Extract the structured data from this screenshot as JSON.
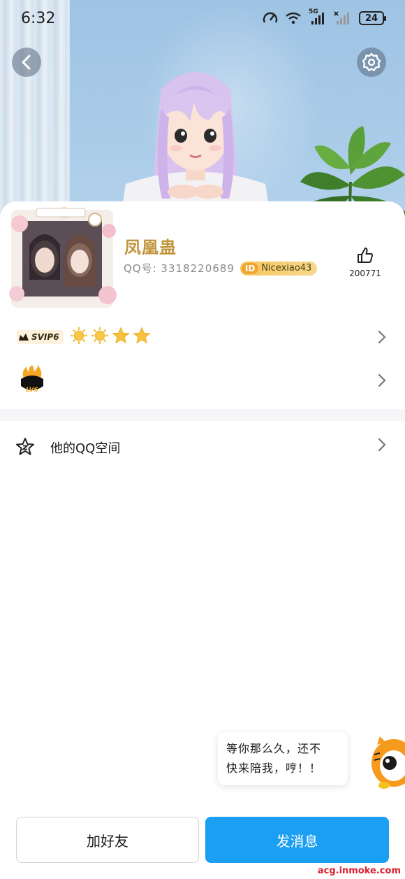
{
  "status_bar": {
    "time": "6:32",
    "network_label": "5G",
    "battery": "24"
  },
  "header": {
    "back_icon": "chevron-left-icon",
    "settings_icon": "gear-icon"
  },
  "profile": {
    "nickname": "凤凰蛊",
    "qq_number_text": "QQ号: 3318220689",
    "id_badge_mark": "ID",
    "id_badge_value": "Nicexiao43",
    "like_count": "200771"
  },
  "vip": {
    "svip_label": "SVIP6",
    "level_icons": [
      "sun-icon",
      "sun-icon",
      "star-icon",
      "star-icon"
    ]
  },
  "game_badge": {
    "label": "LV6"
  },
  "qzone": {
    "label": "他的QQ空间"
  },
  "bubble": {
    "line1": "等你那么久，还不",
    "line2": "快来陪我，哼！！"
  },
  "actions": {
    "add_friend": "加好友",
    "send_message": "发消息"
  },
  "watermark": "acg.inmoke.com",
  "colors": {
    "primary_blue": "#1a9ff2",
    "nickname_gold": "#c2943e",
    "id_badge": "#f6c65e"
  }
}
